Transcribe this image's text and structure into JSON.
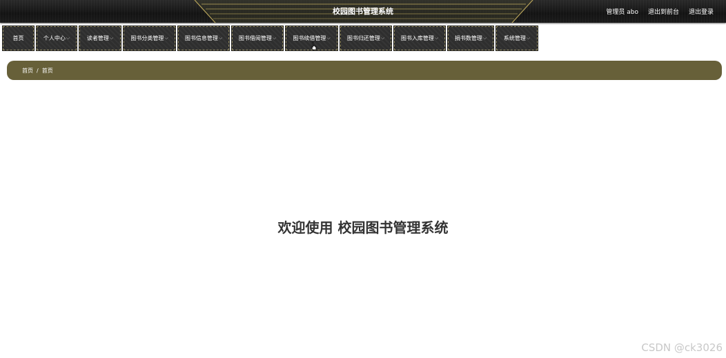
{
  "header": {
    "title": "校园图书管理系统",
    "admin_label": "管理员 abo",
    "exit_front": "退出到前台",
    "logout": "退出登录"
  },
  "nav": {
    "items": [
      {
        "label": "首页",
        "dropdown": false
      },
      {
        "label": "个人中心",
        "dropdown": true
      },
      {
        "label": "读者管理",
        "dropdown": true
      },
      {
        "label": "图书分类管理",
        "dropdown": true
      },
      {
        "label": "图书信息管理",
        "dropdown": true
      },
      {
        "label": "图书借阅管理",
        "dropdown": true
      },
      {
        "label": "图书续借管理",
        "dropdown": true
      },
      {
        "label": "图书归还管理",
        "dropdown": true
      },
      {
        "label": "图书入库管理",
        "dropdown": true
      },
      {
        "label": "捐书数管理",
        "dropdown": true
      },
      {
        "label": "系统管理",
        "dropdown": true
      }
    ]
  },
  "breadcrumb": {
    "items": [
      "首页",
      "首页"
    ],
    "separator": "/"
  },
  "main": {
    "welcome": "欢迎使用 校园图书管理系统"
  },
  "watermark": "CSDN @ck3026",
  "colors": {
    "header_bg": "#1b1b1b",
    "breadcrumb_bg": "#676039",
    "nav_border": "#9c9368",
    "nav_bg": "#2e2e2e",
    "accent_gold": "#b7a35a"
  }
}
